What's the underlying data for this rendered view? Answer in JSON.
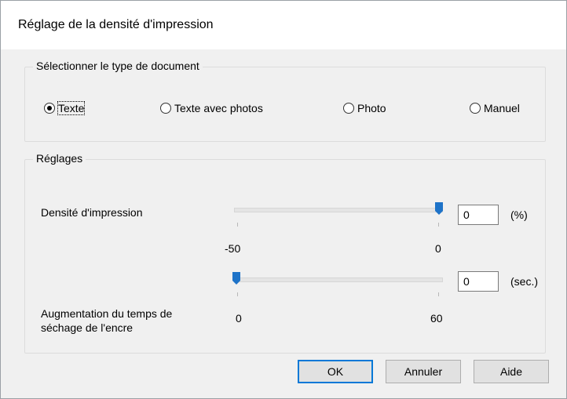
{
  "window": {
    "title": "Réglage de la densité d'impression"
  },
  "doc_type": {
    "label": "Sélectionner le type de document",
    "options": [
      {
        "label": "Texte",
        "checked": true
      },
      {
        "label": "Texte avec photos",
        "checked": false
      },
      {
        "label": "Photo",
        "checked": false
      },
      {
        "label": "Manuel",
        "checked": false
      }
    ]
  },
  "settings": {
    "label": "Réglages",
    "density": {
      "label": "Densité d'impression",
      "min_label": "-50",
      "max_label": "0",
      "min": -50,
      "max": 0,
      "value": "0",
      "unit": "(%)"
    },
    "drying": {
      "label_line1": "Augmentation du temps de",
      "label_line2": "séchage de l'encre",
      "min_label": "0",
      "max_label": "60",
      "min": 0,
      "max": 60,
      "value": "0",
      "unit": "(sec.)"
    }
  },
  "buttons": {
    "ok": "OK",
    "cancel": "Annuler",
    "help": "Aide"
  },
  "colors": {
    "accent": "#0078d7",
    "thumb": "#1e73c8"
  }
}
